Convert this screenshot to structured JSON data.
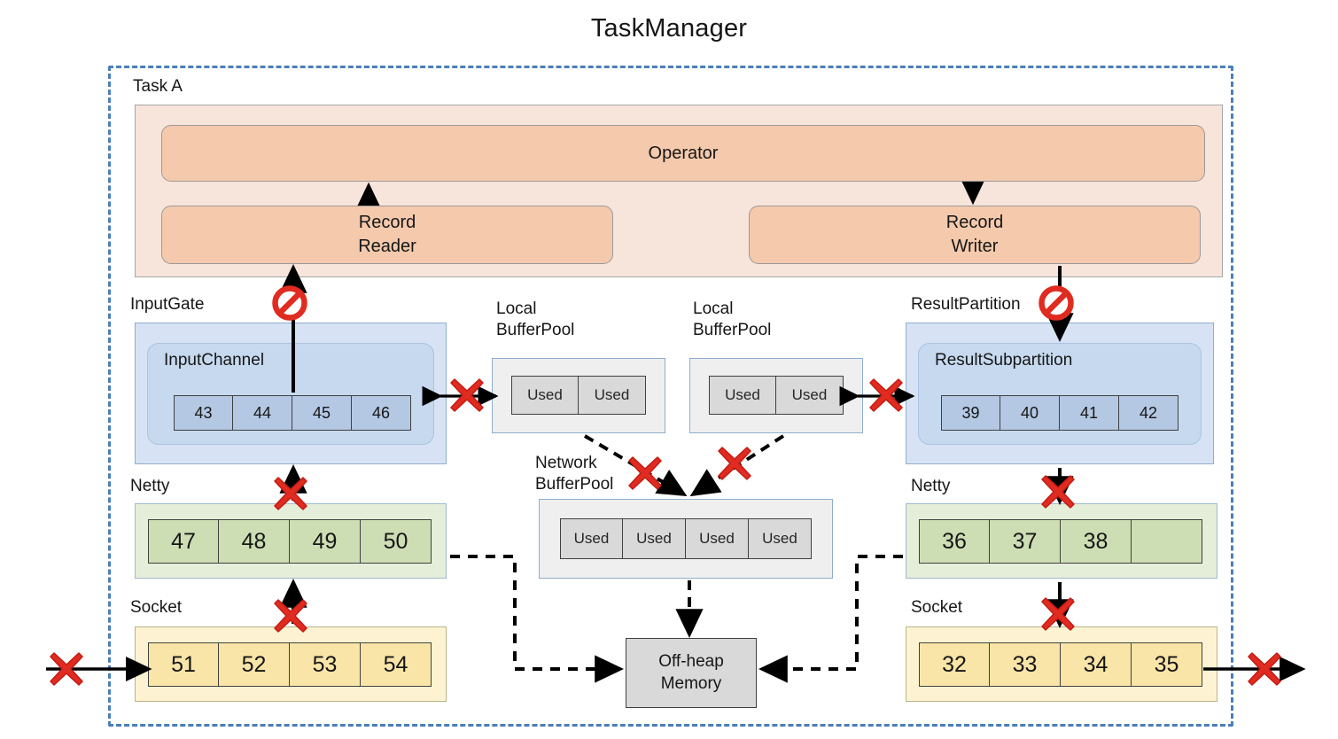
{
  "title": "TaskManager",
  "frame": {
    "label": "Task A"
  },
  "task": {
    "operator": "Operator",
    "record_reader": "Record\nReader",
    "record_reader_line1": "Record",
    "record_reader_line2": "Reader",
    "record_writer_line1": "Record",
    "record_writer_line2": "Writer"
  },
  "input_side": {
    "gate_label": "InputGate",
    "channel_label": "InputChannel",
    "buffers": [
      "43",
      "44",
      "45",
      "46"
    ],
    "netty_label": "Netty",
    "netty_buffers": [
      "47",
      "48",
      "49",
      "50"
    ],
    "socket_label": "Socket",
    "socket_buffers": [
      "51",
      "52",
      "53",
      "54"
    ]
  },
  "output_side": {
    "partition_label": "ResultPartition",
    "subpartition_label": "ResultSubpartition",
    "buffers": [
      "39",
      "40",
      "41",
      "42"
    ],
    "netty_label": "Netty",
    "netty_buffers": [
      "36",
      "37",
      "38",
      ""
    ],
    "socket_label": "Socket",
    "socket_buffers": [
      "32",
      "33",
      "34",
      "35"
    ]
  },
  "pools": {
    "local_left": {
      "label_line1": "Local",
      "label_line2": "BufferPool",
      "cells": [
        "Used",
        "Used"
      ]
    },
    "local_right": {
      "label_line1": "Local",
      "label_line2": "BufferPool",
      "cells": [
        "Used",
        "Used"
      ]
    },
    "network": {
      "label_line1": "Network",
      "label_line2": "BufferPool",
      "cells": [
        "Used",
        "Used",
        "Used",
        "Used"
      ]
    }
  },
  "memory": {
    "label_line1": "Off-heap",
    "label_line2": "Memory"
  },
  "icons": {
    "blocked": "no-entry-icon",
    "cross": "red-cross-icon"
  },
  "colors": {
    "frame_border": "#4a7ebb",
    "task_panel": "#f7e4da",
    "operator_fill": "#f4c9ac",
    "gate_outer": "#d7e3f4",
    "gate_inner": "#c6d9ef",
    "buffer_blue": "#b4c8e3",
    "netty_green": "#cedeb4",
    "socket_yellow": "#fae5a8",
    "pool_gray": "#d9d9d9",
    "cross_red": "#e02b20",
    "arrow_black": "#000000"
  }
}
